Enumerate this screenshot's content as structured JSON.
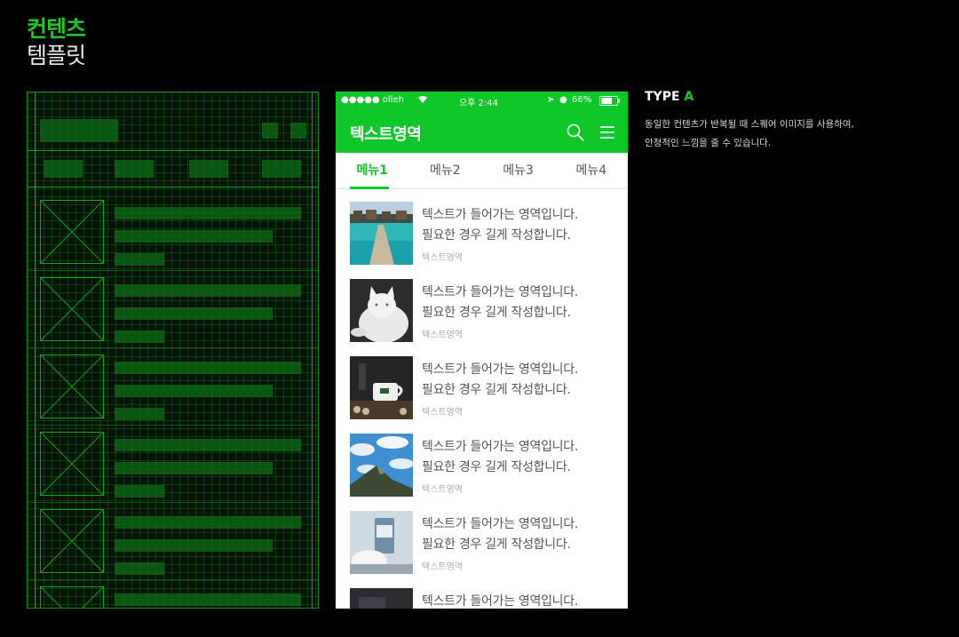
{
  "heading": {
    "line1": "컨텐츠",
    "line2": "템플릿"
  },
  "colors": {
    "accent": "#10c729",
    "background": "#000000"
  },
  "phone": {
    "status": {
      "carrier": "●●●●● olleh",
      "time": "오후 2:44",
      "battery": "66%"
    },
    "app_title": "텍스트영역",
    "icons": [
      "search-icon",
      "menu-icon"
    ],
    "tabs": [
      "메뉴1",
      "메뉴2",
      "메뉴3",
      "메뉴4"
    ],
    "active_tab": 0,
    "items": [
      {
        "line1": "텍스트가 들어가는 영역입니다.",
        "line2": "필요한 경우 길게 작성합니다.",
        "sub": "텍스트영역",
        "image": "pier-photo"
      },
      {
        "line1": "텍스트가 들어가는 영역입니다.",
        "line2": "필요한 경우 길게 작성합니다.",
        "sub": "텍스트영역",
        "image": "cat-photo"
      },
      {
        "line1": "텍스트가 들어가는 영역입니다.",
        "line2": "필요한 경우 길게 작성합니다.",
        "sub": "텍스트영역",
        "image": "coffee-photo"
      },
      {
        "line1": "텍스트가 들어가는 영역입니다.",
        "line2": "필요한 경우 길게 작성합니다.",
        "sub": "텍스트영역",
        "image": "mountain-photo"
      },
      {
        "line1": "텍스트가 들어가는 영역입니다.",
        "line2": "필요한 경우 길게 작성합니다.",
        "sub": "텍스트영역",
        "image": "cup-photo"
      },
      {
        "line1": "텍스트가 들어가는 영역입니다.",
        "line2": "",
        "sub": "",
        "image": "dark-photo"
      }
    ]
  },
  "type_info": {
    "label": "TYPE",
    "letter": "A",
    "desc1": "동일한 컨텐츠가 반복될 때 스퀘어 이미지를 사용하여,",
    "desc2": "안정적인 느낌을 줄 수 있습니다."
  }
}
